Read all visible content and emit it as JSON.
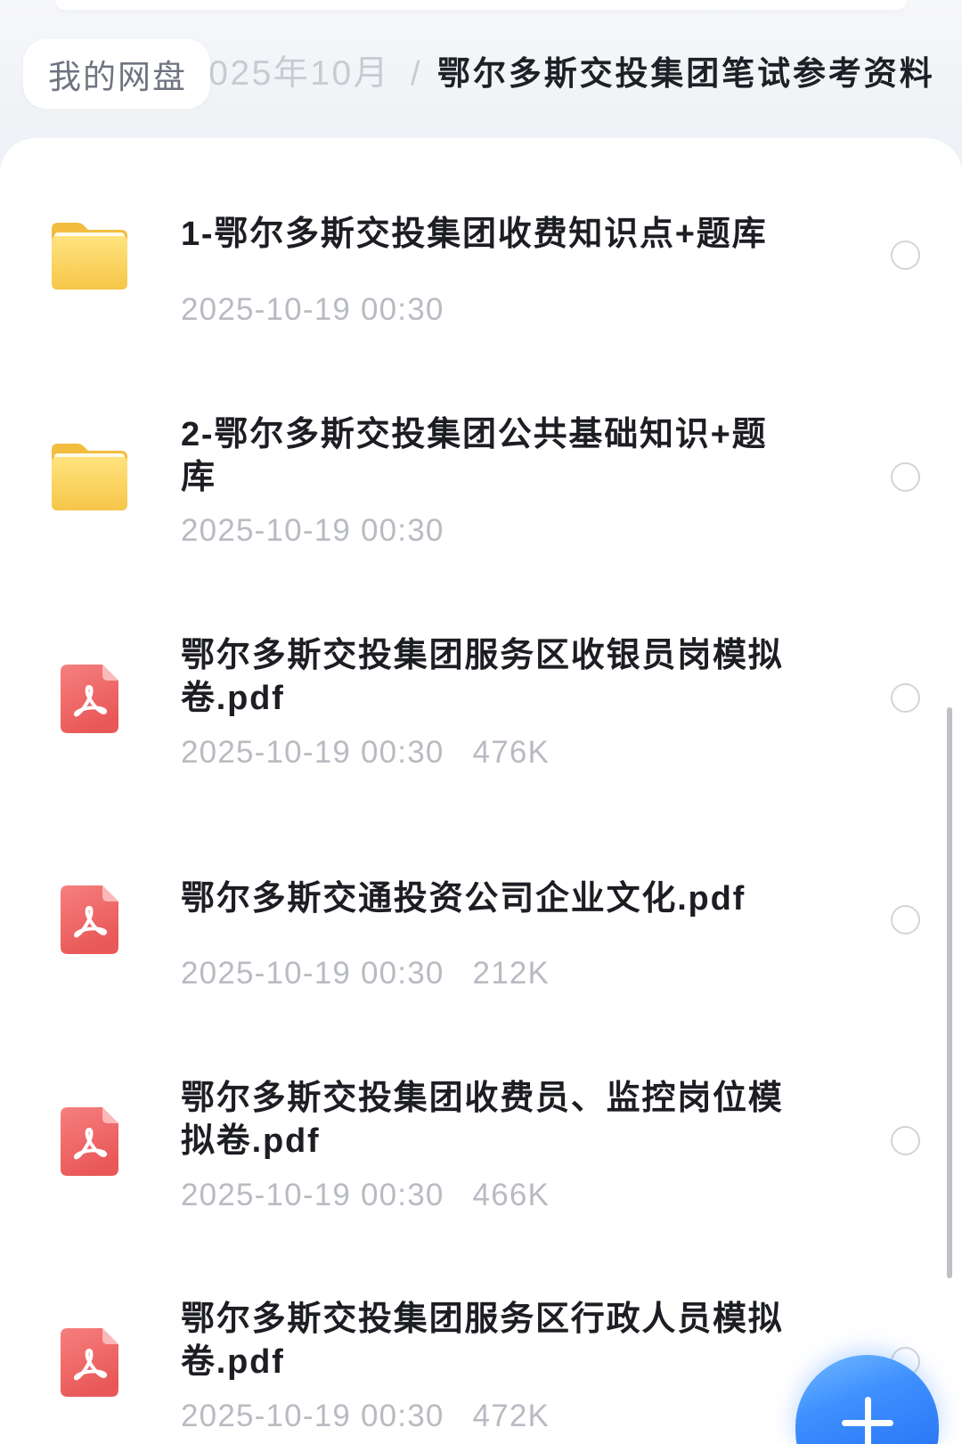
{
  "breadcrumb": {
    "root": "我的网盘",
    "parent": "2025年10月",
    "separator": "/",
    "current": "鄂尔多斯交投集团笔试参考资料"
  },
  "files": [
    {
      "icon": "folder-icon",
      "name": "1-鄂尔多斯交投集团收费知识点+题库",
      "modified": "2025-10-19 00:30",
      "selected": false
    },
    {
      "icon": "folder-icon",
      "name": "2-鄂尔多斯交投集团公共基础知识+题库",
      "modified": "2025-10-19 00:30",
      "selected": false
    },
    {
      "icon": "pdf-icon",
      "name": "鄂尔多斯交投集团服务区收银员岗模拟卷.pdf",
      "modified": "2025-10-19 00:30",
      "size": "476K",
      "selected": false
    },
    {
      "icon": "pdf-icon",
      "name": "鄂尔多斯交通投资公司企业文化.pdf",
      "modified": "2025-10-19 00:30",
      "size": "212K",
      "selected": false
    },
    {
      "icon": "pdf-icon",
      "name": "鄂尔多斯交投集团收费员、监控岗位模拟卷.pdf",
      "modified": "2025-10-19 00:30",
      "size": "466K",
      "selected": false
    },
    {
      "icon": "pdf-icon",
      "name": "鄂尔多斯交投集团服务区行政人员模拟卷.pdf",
      "modified": "2025-10-19 00:30",
      "size": "472K",
      "selected": false
    }
  ],
  "fab": {
    "icon": "plus-icon"
  },
  "colors": {
    "accent": "#3f90ff",
    "folder": "#f9cf55",
    "pdf": "#ee6262",
    "text_primary": "#1c1e23",
    "text_secondary": "#b8bbc2",
    "background": "#eef1f5"
  }
}
